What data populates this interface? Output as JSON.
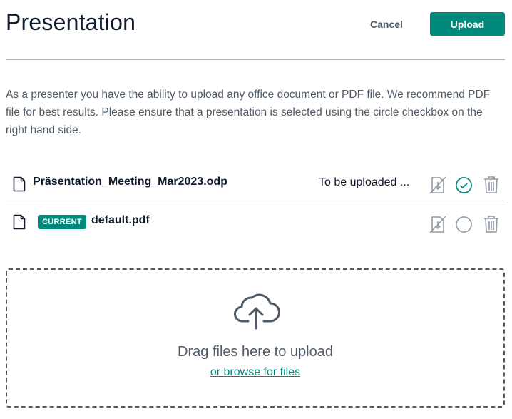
{
  "header": {
    "title": "Presentation",
    "cancel_label": "Cancel",
    "upload_label": "Upload"
  },
  "description": "As a presenter you have the ability to upload any office document or PDF file. We recommend PDF file for best results. Please ensure that a presentation is selected using the circle checkbox on the right hand side.",
  "files": [
    {
      "name": "Präsentation_Meeting_Mar2023.odp",
      "status": "To be uploaded ...",
      "badge": null,
      "selected": true,
      "icons": [
        "file-icon",
        "download-disabled-icon",
        "check-circle-icon",
        "trash-icon"
      ]
    },
    {
      "name": "default.pdf",
      "status": "",
      "badge": "CURRENT",
      "selected": false,
      "icons": [
        "file-icon",
        "download-disabled-icon",
        "empty-circle-icon",
        "trash-icon"
      ]
    }
  ],
  "dropzone": {
    "icon": "cloud-upload-icon",
    "drag_text": "Drag files here to upload",
    "browse_text": "or browse for files"
  },
  "colors": {
    "accent": "#008a7d",
    "text": "#0f1b2d",
    "muted": "#4e5a66",
    "icon_gray": "#8f9ba6",
    "divider": "#a7b3bd"
  }
}
